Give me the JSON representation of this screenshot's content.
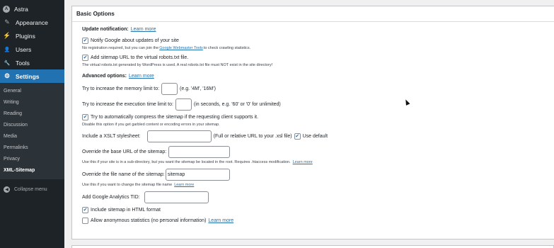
{
  "sidebar": {
    "items": [
      {
        "label": "Astra",
        "icon": "A"
      },
      {
        "label": "Appearance",
        "icon": "✎"
      },
      {
        "label": "Plugins",
        "icon": "⚡"
      },
      {
        "label": "Users",
        "icon": "👤"
      },
      {
        "label": "Tools",
        "icon": "🔧"
      },
      {
        "label": "Settings",
        "icon": "⚙"
      }
    ],
    "submenu": [
      "General",
      "Writing",
      "Reading",
      "Discussion",
      "Media",
      "Permalinks",
      "Privacy",
      "XML-Sitemap"
    ],
    "collapse_label": "Collapse menu",
    "collapse_icon": "◀"
  },
  "panel": {
    "title": "Basic Options",
    "update_notification": {
      "heading": "Update notification:",
      "link": "Learn more"
    },
    "notify_google": {
      "label": "Notify Google about updates of your site",
      "checked": true,
      "help_prefix": "No registration required, but you can join the ",
      "help_link": "Google Webmaster Tools",
      "help_suffix": " to check crawling statistics."
    },
    "add_sitemap_url": {
      "label": "Add sitemap URL to the virtual robots.txt file.",
      "checked": true,
      "help": "The virtual robots.txt generated by WordPress is used. A real robots.txt file must NOT exist in the site directory!"
    },
    "advanced": {
      "heading": "Advanced options:",
      "link": "Learn more"
    },
    "memory": {
      "label": "Try to increase the memory limit to:",
      "value": "",
      "hint": "(e.g. '4M', '16M')"
    },
    "exec_time": {
      "label": "Try to increase the execution time limit to:",
      "value": "",
      "hint": "(in seconds, e.g. '60' or '0' for unlimited)"
    },
    "compress": {
      "label": "Try to automatically compress the sitemap if the requesting client supports it.",
      "checked": true,
      "help": "Disable this option if you get garbled content or encoding errors in your sitemap."
    },
    "xslt": {
      "label": "Include a XSLT stylesheet:",
      "value": "",
      "hint": "(Full or relative URL to your .xsl file)",
      "use_default": "Use default",
      "use_default_checked": true
    },
    "base_url": {
      "label": "Override the base URL of the sitemap:",
      "value": "",
      "help": "Use this if your site is in a sub-directory, but you want the sitemap be located in the root. Requires .htaccess modification.",
      "help_link": "Learn more"
    },
    "file_name": {
      "label": "Override the file name of the sitemap:",
      "value": "sitemap",
      "help": "Use this if you want to change the sitemap file name",
      "help_link": "Learn more"
    },
    "ga_tid": {
      "label": "Add Google Analytics TID:",
      "value": ""
    },
    "html_format": {
      "label": "Include sitemap in HTML format",
      "checked": true
    },
    "anon_stats": {
      "label": "Allow anonymous statistics (no personal information)",
      "checked": false,
      "link": "Learn more"
    }
  }
}
